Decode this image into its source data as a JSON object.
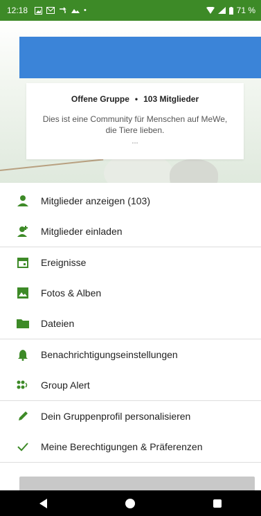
{
  "status_bar": {
    "time": "12:18",
    "battery": "71 %",
    "icons": [
      "image-icon",
      "mail-icon",
      "call-forward-icon",
      "gallery-icon",
      "dot-icon"
    ]
  },
  "group": {
    "type_label": "Offene Gruppe",
    "separator": "•",
    "members_label": "103 Mitglieder",
    "description": "Dies ist eine Community für Menschen auf MeWe, die Tiere lieben.",
    "more": "..."
  },
  "menu": [
    {
      "id": "members",
      "icon": "person-icon",
      "label": "Mitglieder anzeigen (103)"
    },
    {
      "id": "invite",
      "icon": "person-add-icon",
      "label": "Mitglieder einladen"
    },
    {
      "id": "events",
      "icon": "calendar-icon",
      "label": "Ereignisse"
    },
    {
      "id": "photos",
      "icon": "image-icon",
      "label": "Fotos & Alben"
    },
    {
      "id": "files",
      "icon": "folder-icon",
      "label": "Dateien"
    },
    {
      "id": "notifications",
      "icon": "bell-icon",
      "label": "Benachrichtigungseinstellungen"
    },
    {
      "id": "alert",
      "icon": "group-alert-icon",
      "label": "Group Alert"
    },
    {
      "id": "profile",
      "icon": "pencil-icon",
      "label": "Dein Gruppenprofil personalisieren"
    },
    {
      "id": "permissions",
      "icon": "check-icon",
      "label": "Meine Berechtigungen & Präferenzen"
    }
  ],
  "colors": {
    "accent_green": "#3d8a27",
    "blue_bar": "#3b84d8"
  }
}
